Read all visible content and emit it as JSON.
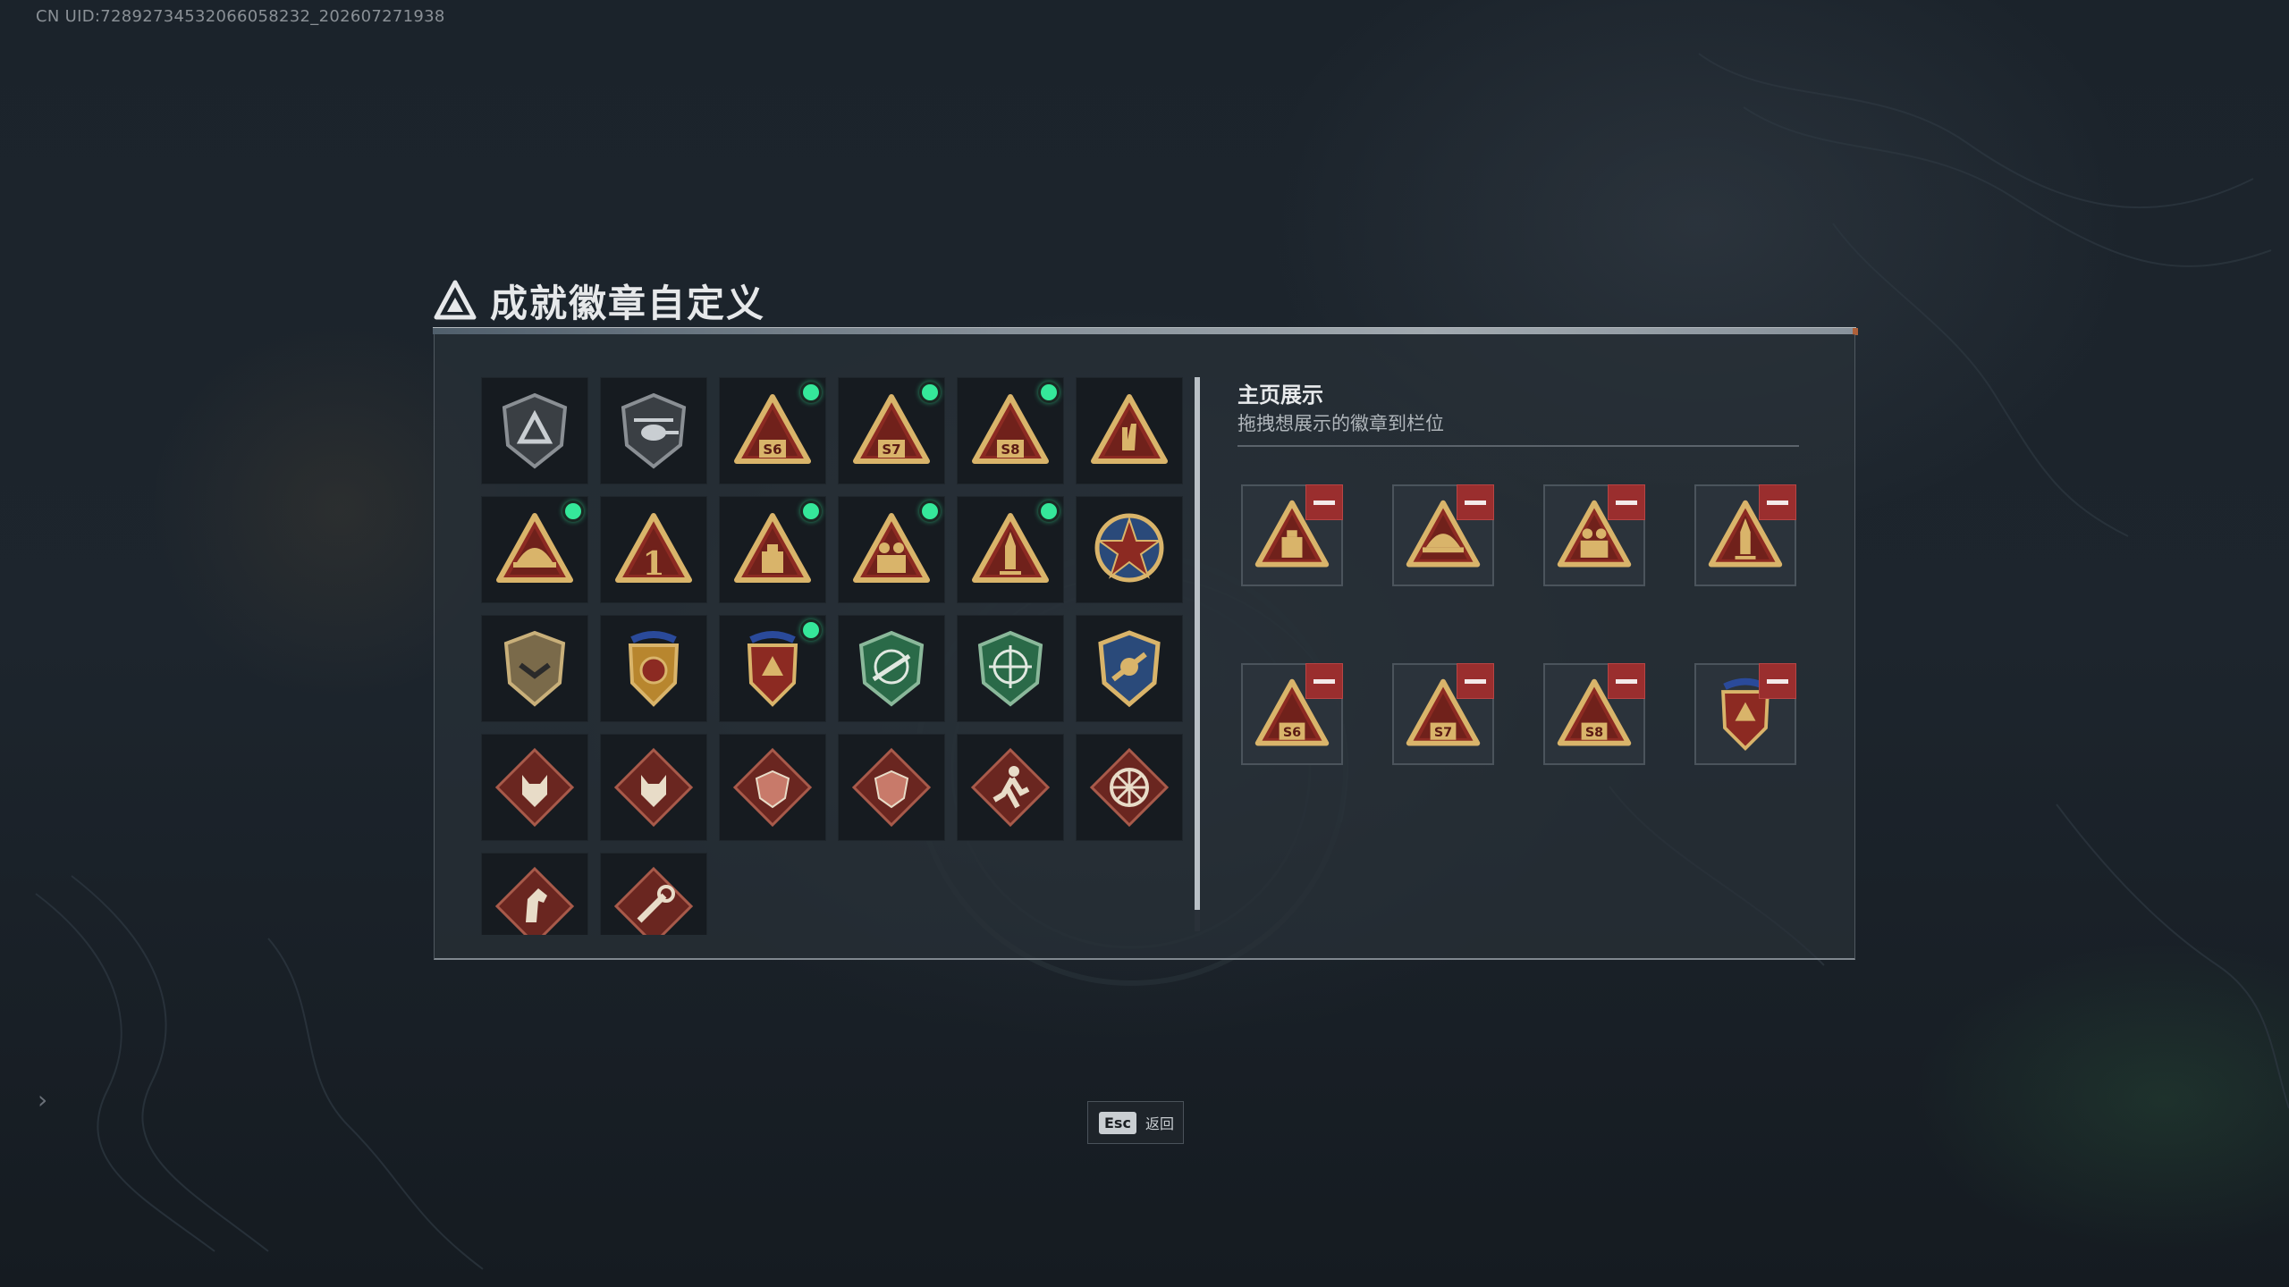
{
  "header": {
    "uid": "CN UID:7289273453206605823​2_202607271938",
    "title": "成就徽章自定义"
  },
  "badges": [
    {
      "icon": "triangle-shield-badge-icon",
      "new": false
    },
    {
      "icon": "helicopter-shield-badge-icon",
      "new": false
    },
    {
      "icon": "s6-triangle-badge-icon",
      "new": true
    },
    {
      "icon": "s7-triangle-badge-icon",
      "new": true
    },
    {
      "icon": "s8-triangle-badge-icon",
      "new": true
    },
    {
      "icon": "hand-sign-triangle-badge-icon",
      "new": false
    },
    {
      "icon": "helmet-triangle-badge-icon",
      "new": true
    },
    {
      "icon": "number-one-triangle-badge-icon",
      "new": false
    },
    {
      "icon": "supply-box-triangle-badge-icon",
      "new": true
    },
    {
      "icon": "soldiers-triangle-badge-icon",
      "new": true
    },
    {
      "icon": "rocket-triangle-badge-icon",
      "new": true
    },
    {
      "icon": "star-compass-medal-icon",
      "new": false
    },
    {
      "icon": "rank-chevron-shield-badge-icon",
      "new": false
    },
    {
      "icon": "gold-shield-stars-badge-icon",
      "new": false
    },
    {
      "icon": "red-shield-stars-badge-icon",
      "new": true
    },
    {
      "icon": "green-rifle-crosshair-badge-icon",
      "new": false
    },
    {
      "icon": "green-crosshair-badge-icon",
      "new": false
    },
    {
      "icon": "gold-wreath-shield-badge-icon",
      "new": false
    },
    {
      "icon": "wolf-diamond-badge-icon",
      "new": false
    },
    {
      "icon": "wolf-diamond-badge-icon-2",
      "new": false
    },
    {
      "icon": "dragon-diamond-badge-icon",
      "new": false
    },
    {
      "icon": "dragon-diamond-badge-icon-2",
      "new": false
    },
    {
      "icon": "runner-diamond-badge-icon",
      "new": false
    },
    {
      "icon": "wheel-diamond-badge-icon",
      "new": false
    },
    {
      "icon": "horse-diamond-badge-icon",
      "new": false
    },
    {
      "icon": "tool-diamond-badge-icon",
      "new": false
    }
  ],
  "showcase": {
    "title": "主页展示",
    "subtitle": "拖拽想展示的徽章到栏位",
    "slots": [
      "supply-box-triangle-badge-icon",
      "helmet-triangle-badge-icon",
      "soldiers-triangle-badge-icon",
      "rocket-triangle-badge-icon",
      "s6-triangle-badge-icon",
      "s7-triangle-badge-icon",
      "s8-triangle-badge-icon",
      "red-shield-stars-badge-icon"
    ]
  },
  "footer": {
    "esc_key": "Esc",
    "esc_label": "返回"
  },
  "colors": {
    "new_indicator": "#35e89a",
    "remove_button": "#9a2e2e",
    "badge_gold": "#d9b46a",
    "badge_red": "#8c2a22"
  }
}
